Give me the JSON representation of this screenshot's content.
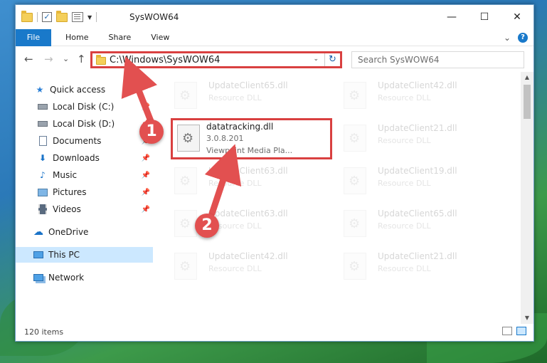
{
  "window": {
    "title": "SysWOW64",
    "minimize_glyph": "—",
    "maximize_glyph": "☐",
    "close_glyph": "✕"
  },
  "ribbon": {
    "tabs": [
      "File",
      "Home",
      "Share",
      "View"
    ],
    "collapse_glyph": "⌄",
    "help_glyph": "?"
  },
  "nav": {
    "back_glyph": "←",
    "forward_glyph": "→",
    "recent_glyph": "⌄",
    "up_glyph": "↑",
    "address": "C:\\Windows\\SysWOW64",
    "dropdown_glyph": "⌄",
    "refresh_glyph": "↻",
    "search_placeholder": "Search SysWOW64"
  },
  "sidebar": {
    "items": [
      {
        "label": "Quick access",
        "icon": "star-icon"
      },
      {
        "label": "Local Disk (C:)",
        "icon": "drive-icon"
      },
      {
        "label": "Local Disk (D:)",
        "icon": "drive-icon"
      },
      {
        "label": "Documents",
        "icon": "documents-icon"
      },
      {
        "label": "Downloads",
        "icon": "download-arrow-icon"
      },
      {
        "label": "Music",
        "icon": "music-note-icon"
      },
      {
        "label": "Pictures",
        "icon": "pictures-icon"
      },
      {
        "label": "Videos",
        "icon": "film-icon"
      },
      {
        "label": "OneDrive",
        "icon": "cloud-icon"
      },
      {
        "label": "This PC",
        "icon": "monitor-icon"
      },
      {
        "label": "Network",
        "icon": "network-icon"
      }
    ],
    "pin_glyph": "📌"
  },
  "files": {
    "tiles": [
      {
        "name": "UpdateClient65.dll",
        "type": "Resource DLL"
      },
      {
        "name": "UpdateClient42.dll",
        "type": "Resource DLL"
      },
      {
        "name": "UpdateClient21.dll",
        "type": "Resource DLL"
      },
      {
        "name": "UpdateClient63.dll",
        "type": "Resource DLL"
      },
      {
        "name": "UpdateClient19.dll",
        "type": "Resource DLL"
      },
      {
        "name": "UpdateClient63.dll",
        "type": "Resource DLL"
      },
      {
        "name": "UpdateClient65.dll",
        "type": "Resource DLL"
      },
      {
        "name": "UpdateClient42.dll",
        "type": "Resource DLL"
      },
      {
        "name": "UpdateClient21.dll",
        "type": "Resource DLL"
      }
    ],
    "selected": {
      "name": "datatracking.dll",
      "version": "3.0.8.201",
      "company": "Viewpoint Media Pla..."
    }
  },
  "scroll": {
    "up_glyph": "▲",
    "down_glyph": "▼"
  },
  "status": {
    "item_count": "120 items"
  },
  "annotations": {
    "step1": "1",
    "step2": "2"
  },
  "colors": {
    "accent": "#1979ca",
    "highlight_border": "#d94040",
    "badge": "#e25050",
    "selection": "#cce8ff"
  }
}
